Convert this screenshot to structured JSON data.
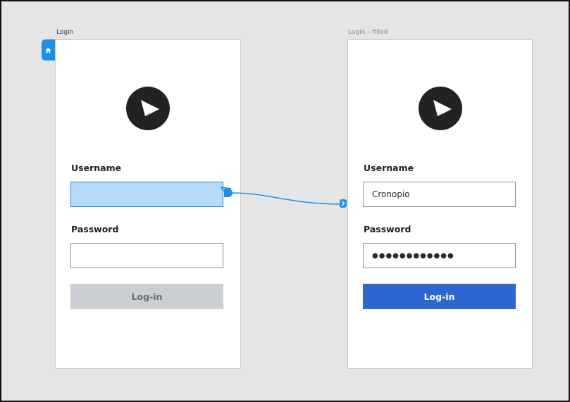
{
  "artboards": {
    "login": {
      "title": "Login",
      "username_label": "Username",
      "username_value": "",
      "password_label": "Password",
      "password_value": "",
      "button_label": "Log-in"
    },
    "login_filled": {
      "title": "Login – filled",
      "username_label": "Username",
      "username_value": "Cronopio",
      "password_label": "Password",
      "password_value": "●●●●●●●●●●●●",
      "button_label": "Log-in"
    }
  },
  "icons": {
    "home": "home-icon",
    "logo": "brand-logo-icon",
    "connector_arrow": "chevron-right-icon"
  },
  "colors": {
    "canvas": "#e5e5e5",
    "accent": "#1e90e8",
    "selection_fill": "#b7dbf6",
    "primary_button": "#2f67d0",
    "disabled_button": "#cbced3"
  }
}
